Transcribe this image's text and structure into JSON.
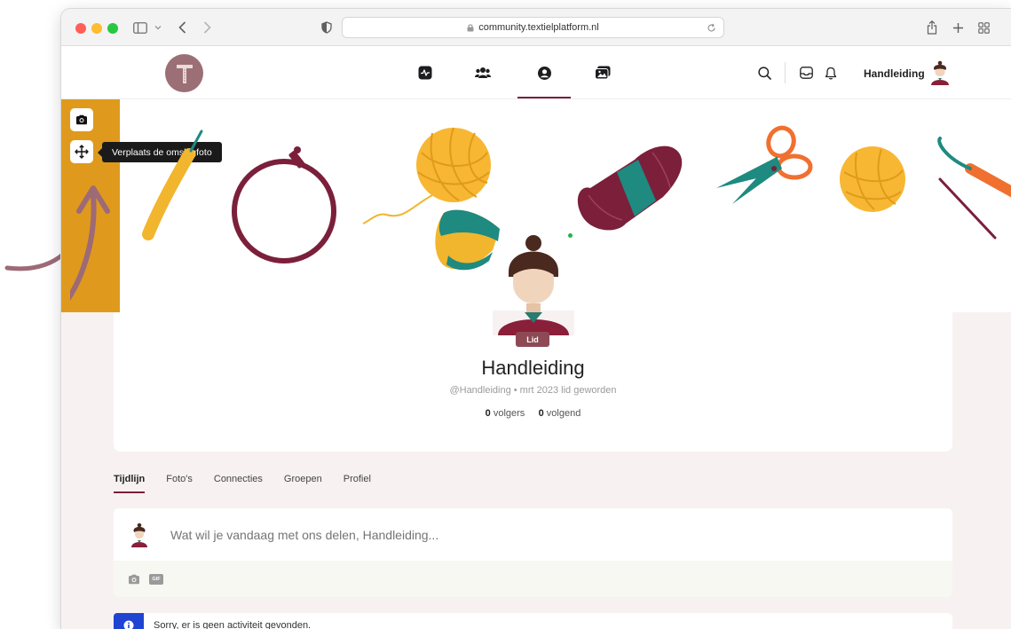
{
  "browser": {
    "url": "community.textielplatform.nl"
  },
  "header": {
    "user_name": "Handleiding",
    "nav": [
      "activity-icon",
      "members-icon",
      "profile-icon",
      "photos-icon"
    ],
    "accent": "#7b1f3a"
  },
  "cover": {
    "tooltip": "Verplaats de omslagfoto",
    "sidebar_color": "#df9a1d"
  },
  "profile": {
    "badge": "Lid",
    "name": "Handleiding",
    "meta": "@Handleiding • mrt 2023 lid geworden",
    "followers_count": "0",
    "followers_label": "volgers",
    "following_count": "0",
    "following_label": "volgend"
  },
  "tabs": [
    {
      "label": "Tijdlijn",
      "active": true
    },
    {
      "label": "Foto's",
      "active": false
    },
    {
      "label": "Connecties",
      "active": false
    },
    {
      "label": "Groepen",
      "active": false
    },
    {
      "label": "Profiel",
      "active": false
    }
  ],
  "composer": {
    "placeholder": "Wat wil je vandaag met ons delen, Handleiding...",
    "gif_label": "GIF"
  },
  "notice": {
    "text": "Sorry, er is geen activiteit gevonden."
  }
}
